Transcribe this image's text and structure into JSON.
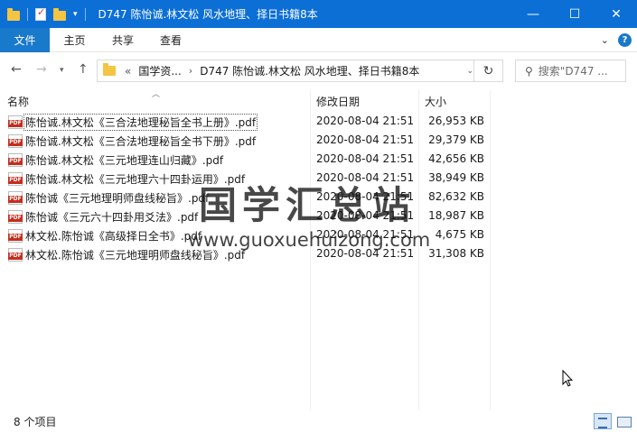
{
  "window": {
    "title": "D747 陈怡诚.林文松 风水地理、择日书籍8本",
    "minimize_glyph": "—",
    "maximize_glyph": "☐",
    "close_glyph": "✕"
  },
  "ribbon": {
    "tabs": [
      "文件",
      "主页",
      "共享",
      "查看"
    ]
  },
  "address": {
    "crumbs": [
      "«",
      "国学资...",
      "›",
      "D747 陈怡诚.林文松 风水地理、择日书籍8本"
    ],
    "search_placeholder": "搜索\"D747 ..."
  },
  "columns": {
    "name": "名称",
    "date": "修改日期",
    "size": "大小"
  },
  "files": [
    {
      "name": "陈怡诚.林文松《三合法地理秘旨全书上册》.pdf",
      "date": "2020-08-04 21:51",
      "size": "26,953 KB"
    },
    {
      "name": "陈怡诚.林文松《三合法地理秘旨全书下册》.pdf",
      "date": "2020-08-04 21:51",
      "size": "29,379 KB"
    },
    {
      "name": "陈怡诚.林文松《三元地理连山归藏》.pdf",
      "date": "2020-08-04 21:51",
      "size": "42,656 KB"
    },
    {
      "name": "陈怡诚.林文松《三元地理六十四卦运用》.pdf",
      "date": "2020-08-04 21:51",
      "size": "38,949 KB"
    },
    {
      "name": "陈怡诚《三元地理明师盘线秘旨》.pdf",
      "date": "2020-08-04 21:51",
      "size": "82,632 KB"
    },
    {
      "name": "陈怡诚《三元六十四卦用爻法》.pdf",
      "date": "2020-08-04 21:51",
      "size": "18,987 KB"
    },
    {
      "name": "林文松.陈怡诚《高级择日全书》.pdf",
      "date": "2020-08-04 21:51",
      "size": "4,675 KB"
    },
    {
      "name": "林文松.陈怡诚《三元地理明师盘线秘旨》.pdf",
      "date": "2020-08-04 21:51",
      "size": "31,308 KB"
    }
  ],
  "watermark": {
    "title": "国学汇总站",
    "url": "www.guoxuehuizong.com"
  },
  "status": {
    "count": "8 个项目"
  },
  "colors": {
    "titlebar": "#0b6fd6",
    "file_tab": "#1979ca",
    "pdf_red": "#c72c1c",
    "folder_yellow": "#f4c542"
  }
}
